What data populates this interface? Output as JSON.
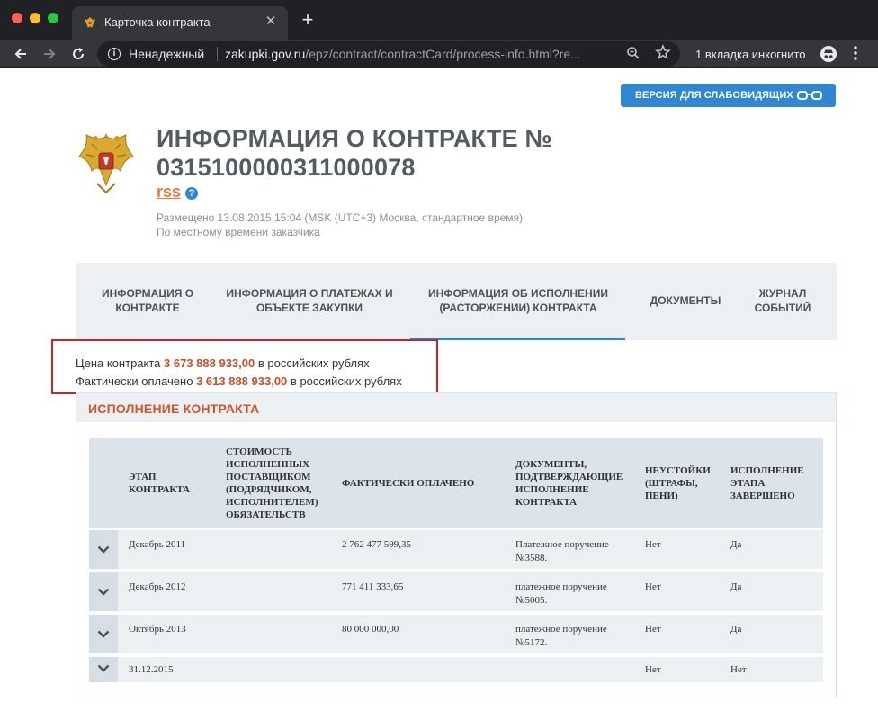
{
  "browser": {
    "tab_title": "Карточка контракта",
    "tab_close": "✕",
    "new_tab": "+",
    "insecure_label": "Ненадежный",
    "url_host": "zakupki.gov.ru",
    "url_path": "/epz/contract/contractCard/process-info.html?re...",
    "incognito_label": "1 вкладка инкогнито"
  },
  "header": {
    "vision_button": "ВЕРСИЯ ДЛЯ СЛАБОВИДЯЩИХ",
    "title_line1": "ИНФОРМАЦИЯ О КОНТРАКТЕ №",
    "title_line2": "0315100000311000078",
    "rss": "rss",
    "help": "?",
    "placed": "Размещено 13.08.2015 15:04 (MSK (UTC+3) Москва, стандартное время)",
    "local_time": "По местному времени заказчика"
  },
  "tabs": [
    {
      "label": "ИНФОРМАЦИЯ О КОНТРАКТЕ"
    },
    {
      "label": "ИНФОРМАЦИЯ О ПЛАТЕЖАХ И ОБЪЕКТЕ ЗАКУПКИ"
    },
    {
      "label": "ИНФОРМАЦИЯ ОБ ИСПОЛНЕНИИ (РАСТОРЖЕНИИ) КОНТРАКТА",
      "active": true
    },
    {
      "label": "ДОКУМЕНТЫ"
    },
    {
      "label": "ЖУРНАЛ СОБЫТИЙ"
    }
  ],
  "price": {
    "contract_label": "Цена контракта",
    "contract_value": "3 673 888 933,00",
    "contract_suffix": "в российских рублях",
    "paid_label": "Фактически оплачено",
    "paid_value": "3 613 888 933,00",
    "paid_suffix": "в российских рублях"
  },
  "execution": {
    "title": "ИСПОЛНЕНИЕ КОНТРАКТА",
    "columns": [
      "ЭТАП КОНТРАКТА",
      "СТОИМОСТЬ ИСПОЛНЕННЫХ ПОСТАВЩИКОМ (ПОДРЯДЧИКОМ, ИСПОЛНИТЕЛЕМ) ОБЯЗАТЕЛЬСТВ",
      "ФАКТИЧЕСКИ ОПЛАЧЕНО",
      "ДОКУМЕНТЫ, ПОДТВЕРЖДАЮЩИЕ ИСПОЛНЕНИЕ КОНТРАКТА",
      "НЕУСТОЙКИ (ШТРАФЫ, ПЕНИ)",
      "ИСПОЛНЕНИЕ ЭТАПА ЗАВЕРШЕНО"
    ],
    "rows": [
      {
        "stage": "Декабрь 2011",
        "cost": "",
        "paid": "2 762 477 599,35",
        "docs": "Платежное поручение №3588.",
        "penalty": "Нет",
        "done": "Да"
      },
      {
        "stage": "Декабрь 2012",
        "cost": "",
        "paid": "771 411 333,65",
        "docs": "платежное поручение №5005.",
        "penalty": "Нет",
        "done": "Да"
      },
      {
        "stage": "Октябрь 2013",
        "cost": "",
        "paid": "80 000 000,00",
        "docs": "платежное поручение №5172.",
        "penalty": "Нет",
        "done": "Да"
      },
      {
        "stage": "31.12.2015",
        "cost": "",
        "paid": "",
        "docs": "",
        "penalty": "Нет",
        "done": "Нет"
      }
    ]
  },
  "colors": {
    "accent_blue": "#2f86d2",
    "highlight_red": "#d1202a",
    "price_orange": "#c4502a",
    "section_title": "#d0562a"
  },
  "icons": [
    "emblem-icon",
    "info-icon",
    "zoom-icon",
    "star-icon",
    "incognito-icon",
    "glasses-icon",
    "help-icon",
    "chevron-down-icon"
  ]
}
